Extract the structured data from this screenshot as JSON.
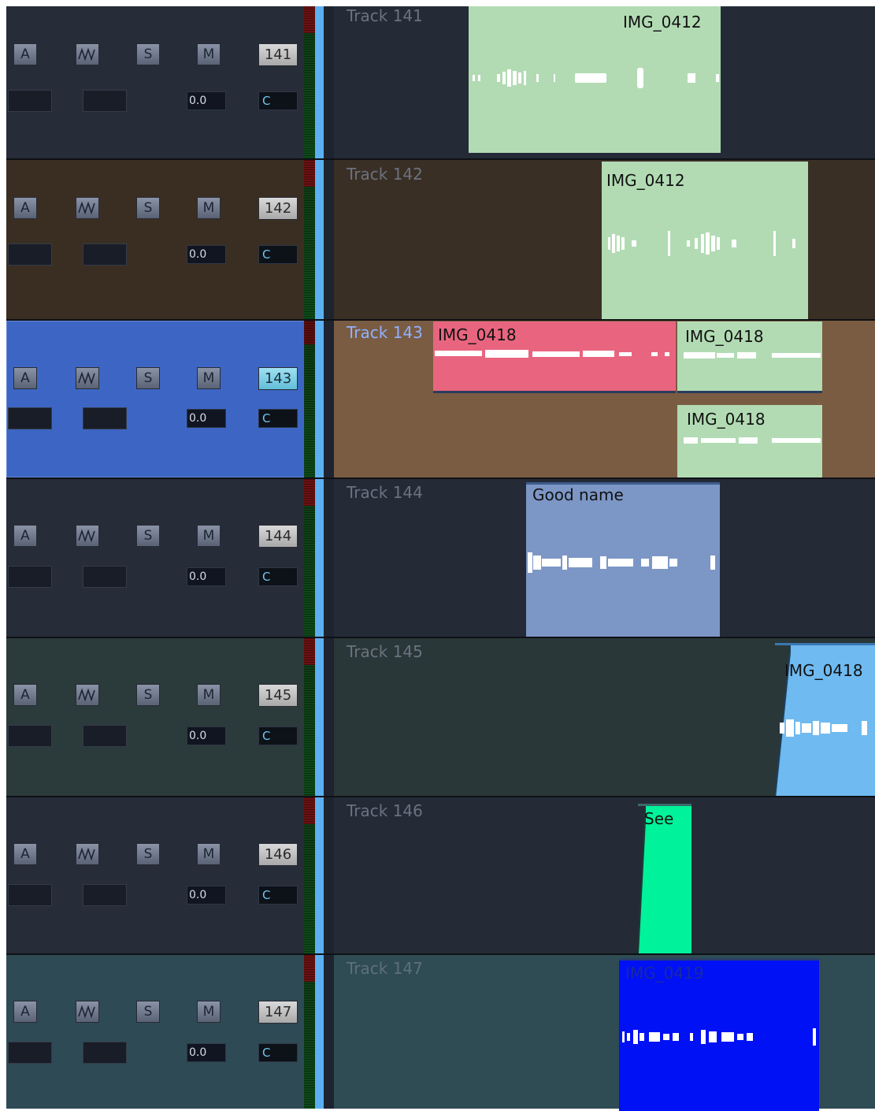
{
  "colors": {
    "lane_default": "#242b37",
    "lane_brown": "#3a2f25",
    "lane_selected": "#7a5c43",
    "lane_green": "#2a3738",
    "lane_teal": "#2f4b53",
    "header_default": "#262c38",
    "header_brown": "#3a2e23",
    "header_selected": "#3d66c4",
    "header_green": "#2b3a3a",
    "header_teal": "#2e4a55",
    "clip_light_green": "#b2dbb4",
    "clip_pink": "#e9657f",
    "clip_periwinkle": "#7c97c6",
    "clip_sky": "#6fbaf0",
    "clip_mint": "#00f29a",
    "clip_blue": "#0011f5"
  },
  "header": {
    "btn_a": "A",
    "btn_s": "S",
    "btn_m": "M",
    "volume": "0.0",
    "pan": "C",
    "wave_icon": "waveform-icon"
  },
  "tracks": [
    {
      "number": "141",
      "lane_label": "Track 141"
    },
    {
      "number": "142",
      "lane_label": "Track 142"
    },
    {
      "number": "143",
      "lane_label": "Track 143"
    },
    {
      "number": "144",
      "lane_label": "Track 144"
    },
    {
      "number": "145",
      "lane_label": "Track 145"
    },
    {
      "number": "146",
      "lane_label": "Track 146"
    },
    {
      "number": "147",
      "lane_label": "Track 147"
    }
  ],
  "clips": {
    "c141": "IMG_0412",
    "c142": "IMG_0412",
    "c143a": "IMG_0418",
    "c143b": "IMG_0418",
    "c143c": "IMG_0418",
    "c144": "Good name",
    "c145": "IMG_0418",
    "c146": "See",
    "c147": "IMG_0419"
  }
}
